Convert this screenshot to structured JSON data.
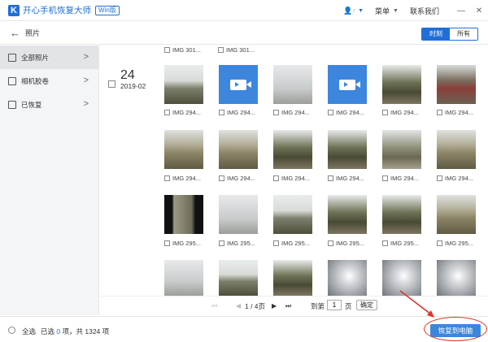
{
  "app": {
    "logo_letter": "K",
    "title": "开心手机恢复大师",
    "edition": "Win版",
    "user_name": "r",
    "menu_label": "菜单",
    "contact_label": "联系我们",
    "minimize": "—",
    "close": "✕"
  },
  "nav": {
    "title": "照片",
    "seg_time": "时刻",
    "seg_all": "所有"
  },
  "sidebar": {
    "items": [
      {
        "label": "全部照片",
        "icon": "document-icon"
      },
      {
        "label": "相机胶卷",
        "icon": "image-icon"
      },
      {
        "label": "已恢复",
        "icon": "image-icon"
      }
    ]
  },
  "group": {
    "day": "24",
    "month": "2019-02"
  },
  "grid": {
    "top_partial": [
      "IMG 301...",
      "IMG 301..."
    ],
    "rows": [
      [
        "IMG 294...",
        "IMG 294...",
        "IMG 294...",
        "IMG 294...",
        "IMG 294...",
        "IMG 294..."
      ],
      [
        "IMG 294...",
        "IMG 294...",
        "IMG 294...",
        "IMG 294...",
        "IMG 294...",
        "IMG 294..."
      ],
      [
        "IMG 295...",
        "IMG 295...",
        "IMG 295...",
        "IMG 295...",
        "IMG 295...",
        "IMG 295..."
      ]
    ]
  },
  "pager": {
    "first": "⏮",
    "prev": "◀",
    "info": "1 / 4页",
    "next": "▶",
    "last": "⏭",
    "goto_label": "到第",
    "goto_value": "1",
    "goto_unit": "页",
    "confirm": "确定"
  },
  "status": {
    "select_all": "全选",
    "selected_prefix": "已选",
    "selected_count": "0",
    "selected_suffix": "项，共 1324 项",
    "recover_button": "恢复到电脑"
  },
  "colors": {
    "accent": "#1f6fd6",
    "video_tile": "#3c86dd",
    "annotation": "#e3332c"
  }
}
